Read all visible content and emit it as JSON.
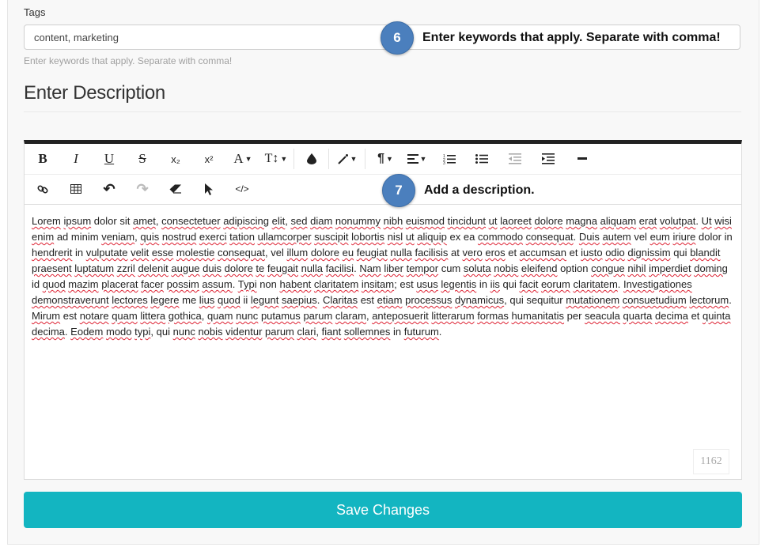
{
  "tags": {
    "label": "Tags",
    "value": "content, marketing",
    "help": "Enter keywords that apply. Separate with comma!"
  },
  "description": {
    "title": "Enter Description",
    "toolbar_row1": [
      {
        "name": "bold-icon",
        "glyph": "B"
      },
      {
        "name": "italic-icon",
        "glyph": "I"
      },
      {
        "name": "underline-icon",
        "glyph": "U"
      },
      {
        "name": "strikethrough-icon",
        "glyph": "S"
      },
      {
        "name": "subscript-icon",
        "glyph": "x₂"
      },
      {
        "name": "superscript-icon",
        "glyph": "x²"
      },
      {
        "name": "font-color-icon",
        "glyph": "A"
      },
      {
        "name": "font-size-icon",
        "glyph": "T↕"
      },
      {
        "name": "ink-drop-icon",
        "glyph": "💧"
      },
      {
        "name": "magic-wand-icon",
        "glyph": "⁄"
      },
      {
        "name": "paragraph-icon",
        "glyph": "¶"
      },
      {
        "name": "align-icon",
        "glyph": "≡"
      },
      {
        "name": "ordered-list-icon",
        "glyph": "1≡"
      },
      {
        "name": "unordered-list-icon",
        "glyph": "•≡"
      },
      {
        "name": "outdent-icon",
        "glyph": "⇤"
      },
      {
        "name": "indent-icon",
        "glyph": "⇥"
      },
      {
        "name": "horizontal-rule-icon",
        "glyph": "—"
      }
    ],
    "toolbar_row2": [
      {
        "name": "link-icon",
        "glyph": "🔗"
      },
      {
        "name": "table-icon",
        "glyph": "▦"
      },
      {
        "name": "undo-icon",
        "glyph": "↶"
      },
      {
        "name": "redo-icon",
        "glyph": "↷"
      },
      {
        "name": "eraser-icon",
        "glyph": "⌫"
      },
      {
        "name": "pointer-icon",
        "glyph": "➤"
      },
      {
        "name": "code-view-icon",
        "glyph": "</>"
      }
    ],
    "text": "Lorem ipsum dolor sit amet, consectetuer adipiscing elit, sed diam nonummy nibh euismod tincidunt ut laoreet dolore magna aliquam erat volutpat. Ut wisi enim ad minim veniam, quis nostrud exerci tation ullamcorper suscipit lobortis nisl ut aliquip ex ea commodo consequat. Duis autem vel eum iriure dolor in hendrerit in vulputate velit esse molestie consequat, vel illum dolore eu feugiat nulla facilisis at vero eros et accumsan et iusto odio dignissim qui blandit praesent luptatum zzril delenit augue duis dolore te feugait nulla facilisi. Nam liber tempor cum soluta nobis eleifend option congue nihil imperdiet doming id quod mazim placerat facer possim assum. Typi non habent claritatem insitam; est usus legentis in iis qui facit eorum claritatem. Investigationes demonstraverunt lectores legere me lius quod ii legunt saepius. Claritas est etiam processus dynamicus, qui sequitur mutationem consuetudium lectorum. Mirum est notare quam littera gothica, quam nunc putamus parum claram, anteposuerit litterarum formas humanitatis per seacula quarta decima et quinta decima. Eodem modo typi, qui nunc nobis videntur parum clari, fiant sollemnes in futurum.",
    "char_count": "1162"
  },
  "callouts": [
    {
      "number": "6",
      "text": "Enter keywords that apply. Separate with comma!"
    },
    {
      "number": "7",
      "text": "Add a description."
    }
  ],
  "save_label": "Save Changes",
  "colors": {
    "accent": "#13b5c1",
    "callout": "#4b7fbd"
  }
}
